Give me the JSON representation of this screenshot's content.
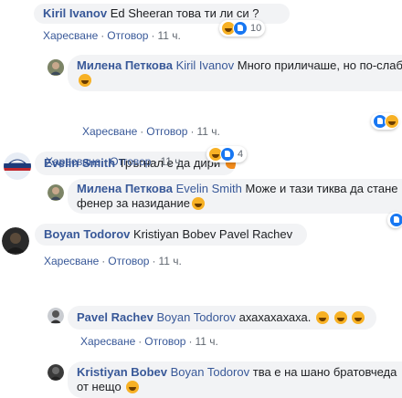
{
  "comments": [
    {
      "author": "Kiril Ivanov",
      "text": "Ed Sheeran това ти ли си ?",
      "like": "Харесване",
      "reply": "Отговор",
      "time": "11 ч.",
      "reaction_count": "10"
    },
    {
      "author": "Милена Петкова",
      "mention": "Kiril Ivanov",
      "text": "Много приличаше, но по-слаб",
      "like": "Харесване",
      "reply": "Отговор",
      "time": "11 ч."
    },
    {
      "author": "Evelin Smith",
      "text": "Тръгнал е да дири",
      "like": "Харесване",
      "reply": "Отговор",
      "time": "11 ч.",
      "reaction_count": "4"
    },
    {
      "author": "Милена Петкова",
      "mention": "Evelin Smith",
      "text": "Може и тази тиква да стане",
      "text2": "фенер за назидание",
      "like": "Харесване",
      "reply": "Отговор",
      "time": "11 ч."
    },
    {
      "author": "Boyan Todorov",
      "text": "Kristiyan Bobev Pavel Rachev",
      "like": "Харесване",
      "reply": "Отговор",
      "time": "11 ч."
    },
    {
      "author": "Pavel Rachev",
      "mention": "Boyan Todorov",
      "text": "ахахахахаха.",
      "like": "Харесване",
      "reply": "Отговор",
      "time": "11 ч."
    },
    {
      "author": "Kristiyan Bobev",
      "mention": "Boyan Todorov",
      "text": "тва е на шано братовчеда",
      "text2": "от нещо"
    }
  ],
  "colors": {
    "link": "#385898",
    "bubble": "#f2f3f5",
    "meta": "#606770"
  }
}
